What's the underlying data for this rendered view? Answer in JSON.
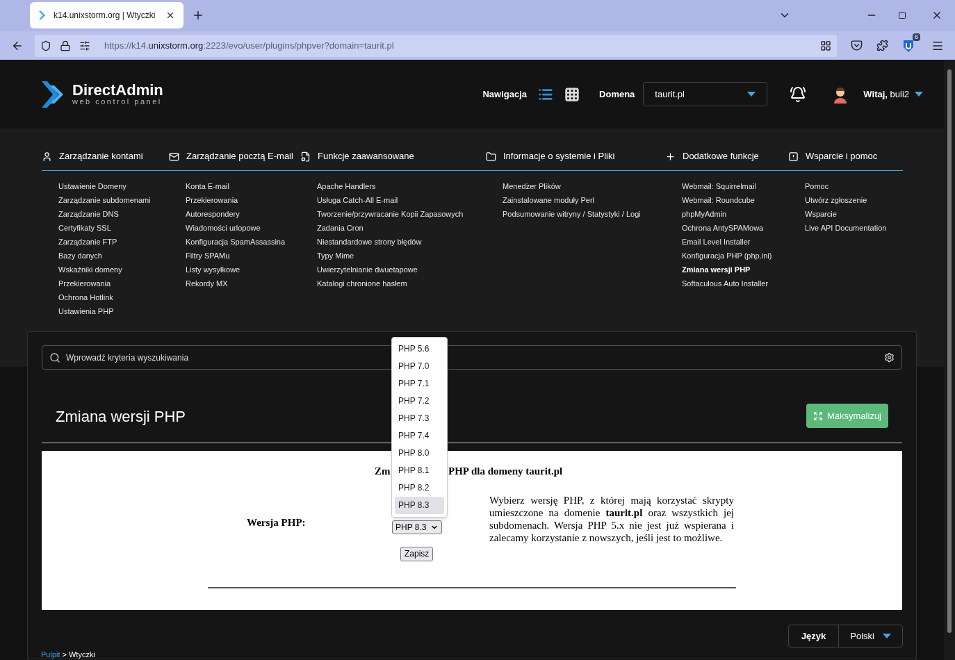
{
  "browser": {
    "tab_title": "k14.unixstorm.org | Wtyczki",
    "url_prefix": "https://k14.",
    "url_host": "unixstorm.org",
    "url_suffix": ":2223/evo/user/plugins/phpver?domain=taurit.pl",
    "extension_badge": "6"
  },
  "header": {
    "logo_title": "DirectAdmin",
    "logo_subtitle": "web control panel",
    "nav_label": "Nawigacja",
    "views": [
      {
        "kind": "list",
        "selected": true
      },
      {
        "kind": "grid",
        "selected": false
      }
    ],
    "domain_label": "Domena",
    "domain_value": "taurit.pl",
    "greeting": "**Witaj,** buli2"
  },
  "menu": [
    {
      "title": "Zarządzanie kontami",
      "items": [
        {
          "label": "Ustawienie Domeny",
          "selected": false
        },
        {
          "label": "Zarządzanie subdomenami",
          "selected": false
        },
        {
          "label": "Zarządzanie DNS",
          "selected": false
        },
        {
          "label": "Certyfikaty SSL",
          "selected": false
        },
        {
          "label": "Zarządzanie FTP",
          "selected": false
        },
        {
          "label": "Bazy danych",
          "selected": false
        },
        {
          "label": "Wskaźniki domeny",
          "selected": false
        },
        {
          "label": "Przekierowania",
          "selected": false
        },
        {
          "label": "Ochrona Hotlink",
          "selected": false
        },
        {
          "label": "Ustawienia PHP",
          "selected": false
        }
      ]
    },
    {
      "title": "Zarządzanie pocztą E-mail",
      "items": [
        {
          "label": "Konta E-mail",
          "selected": false
        },
        {
          "label": "Przekierowania",
          "selected": false
        },
        {
          "label": "Autorespondery",
          "selected": false
        },
        {
          "label": "Wiadomości urlopowe",
          "selected": false
        },
        {
          "label": "Konfiguracja SpamAssassina",
          "selected": false
        },
        {
          "label": "Filtry SPAMu",
          "selected": false
        },
        {
          "label": "Listy wysyłkowe",
          "selected": false
        },
        {
          "label": "Rekordy MX",
          "selected": false
        }
      ]
    },
    {
      "title": "Funkcje zaawansowane",
      "items": [
        {
          "label": "Apache Handlers",
          "selected": false
        },
        {
          "label": "Usługa Catch-All E-mail",
          "selected": false
        },
        {
          "label": "Tworzenie/przywracanie Kopii Zapasowych",
          "selected": false
        },
        {
          "label": "Zadania Cron",
          "selected": false
        },
        {
          "label": "Niestandardowe strony błędów",
          "selected": false
        },
        {
          "label": "Typy Mime",
          "selected": false
        },
        {
          "label": "Uwierzytelnianie dwuetapowe",
          "selected": false
        },
        {
          "label": "Katalogi chronione hasłem",
          "selected": false
        }
      ]
    },
    {
      "title": "Informacje o systemie i Pliki",
      "items": [
        {
          "label": "Menedżer Plików",
          "selected": false
        },
        {
          "label": "Zainstalowane moduły Perl",
          "selected": false
        },
        {
          "label": "Podsumowanie witryny / Statystyki / Logi",
          "selected": false
        }
      ]
    },
    {
      "title": "Dodatkowe funkcje",
      "items": [
        {
          "label": "Webmail: Squirrelmail",
          "selected": false
        },
        {
          "label": "Webmail: Roundcube",
          "selected": false
        },
        {
          "label": "phpMyAdmin",
          "selected": false
        },
        {
          "label": "Ochrona AntySPAMowa",
          "selected": false
        },
        {
          "label": "Email Level Installer",
          "selected": false
        },
        {
          "label": "Konfiguracja PHP (php.ini)",
          "selected": false
        },
        {
          "label": "Zmiana wersji PHP",
          "selected": true
        },
        {
          "label": "Softaculous Auto Installer",
          "selected": false
        }
      ]
    },
    {
      "title": "Wsparcie i pomoc",
      "items": [
        {
          "label": "Pomoc",
          "selected": false
        },
        {
          "label": "Utwórz zgłoszenie",
          "selected": false
        },
        {
          "label": "Wsparcie",
          "selected": false
        },
        {
          "label": "Live API Documentation",
          "selected": false
        }
      ]
    }
  ],
  "search": {
    "placeholder": "Wprowadź kryteria wyszukiwania"
  },
  "page_title": "Zmiana wersji PHP",
  "maximize_button": "Maksymalizuj",
  "form": {
    "heading_start": "Zm",
    "heading_end": "PHP dla domeny taurit.pl",
    "version_label": "Wersja PHP:",
    "select_value": "PHP 8.3",
    "options": [
      {
        "label": "PHP 5.6",
        "selected": false
      },
      {
        "label": "PHP 7.0",
        "selected": false
      },
      {
        "label": "PHP 7.1",
        "selected": false
      },
      {
        "label": "PHP 7.2",
        "selected": false
      },
      {
        "label": "PHP 7.3",
        "selected": false
      },
      {
        "label": "PHP 7.4",
        "selected": false
      },
      {
        "label": "PHP 8.0",
        "selected": false
      },
      {
        "label": "PHP 8.1",
        "selected": false
      },
      {
        "label": "PHP 8.2",
        "selected": false
      },
      {
        "label": "PHP 8.3",
        "selected": true
      }
    ],
    "description": "Wybierz wersję PHP, z której mają korzystać skrypty umieszczone na domenie **taurit.pl** oraz wszystkich jej subdomenach. Wersja PHP 5.x nie jest już wspierana i zalecamy korzystanie z nowszych, jeśli jest to możliwe.",
    "save_button": "Zapisz"
  },
  "footer": {
    "language_label": "Język",
    "language_value": "Polski",
    "breadcrumb": {
      "link": "Pulpit",
      "separator": ">",
      "current": "Wtyczki"
    }
  }
}
